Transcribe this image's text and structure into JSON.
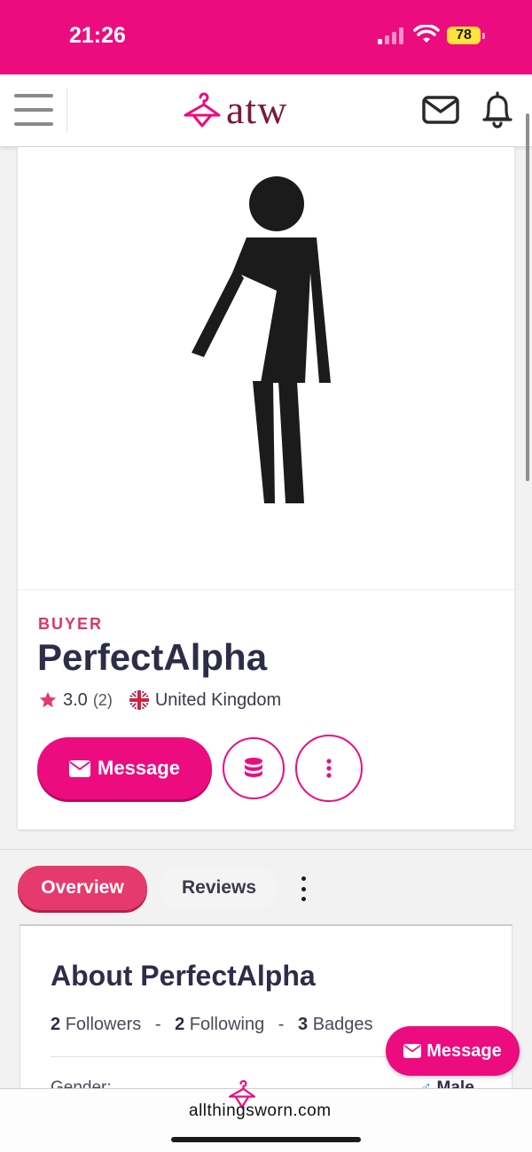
{
  "status_bar": {
    "time": "21:26",
    "battery": "78"
  },
  "navbar": {
    "logo_text": "atw",
    "icons": [
      "menu-icon",
      "hanger-logo-icon",
      "mail-icon",
      "bell-icon"
    ]
  },
  "profile": {
    "role": "BUYER",
    "name": "PerfectAlpha",
    "rating": "3.0",
    "rating_count": "(2)",
    "country": "United Kingdom",
    "message_label": "Message",
    "avatar_icon": "female-silhouette-icon"
  },
  "tabs": [
    {
      "label": "Overview",
      "active": true
    },
    {
      "label": "Reviews",
      "active": false
    }
  ],
  "about": {
    "title": "About PerfectAlpha",
    "followers_count": "2",
    "followers_label": "Followers",
    "following_count": "2",
    "following_label": "Following",
    "badges_count": "3",
    "badges_label": "Badges",
    "separator": "-",
    "gender_label": "Gender:",
    "gender_symbol": "♂",
    "gender_value": "Male"
  },
  "fab": {
    "label": "Message"
  },
  "bottom_bar": {
    "url": "allthingsworn.com"
  },
  "colors": {
    "brand": "#ec0c80",
    "tab_active": "#e63a6e",
    "role": "#e0336c",
    "text_dark": "#2d2d48"
  }
}
